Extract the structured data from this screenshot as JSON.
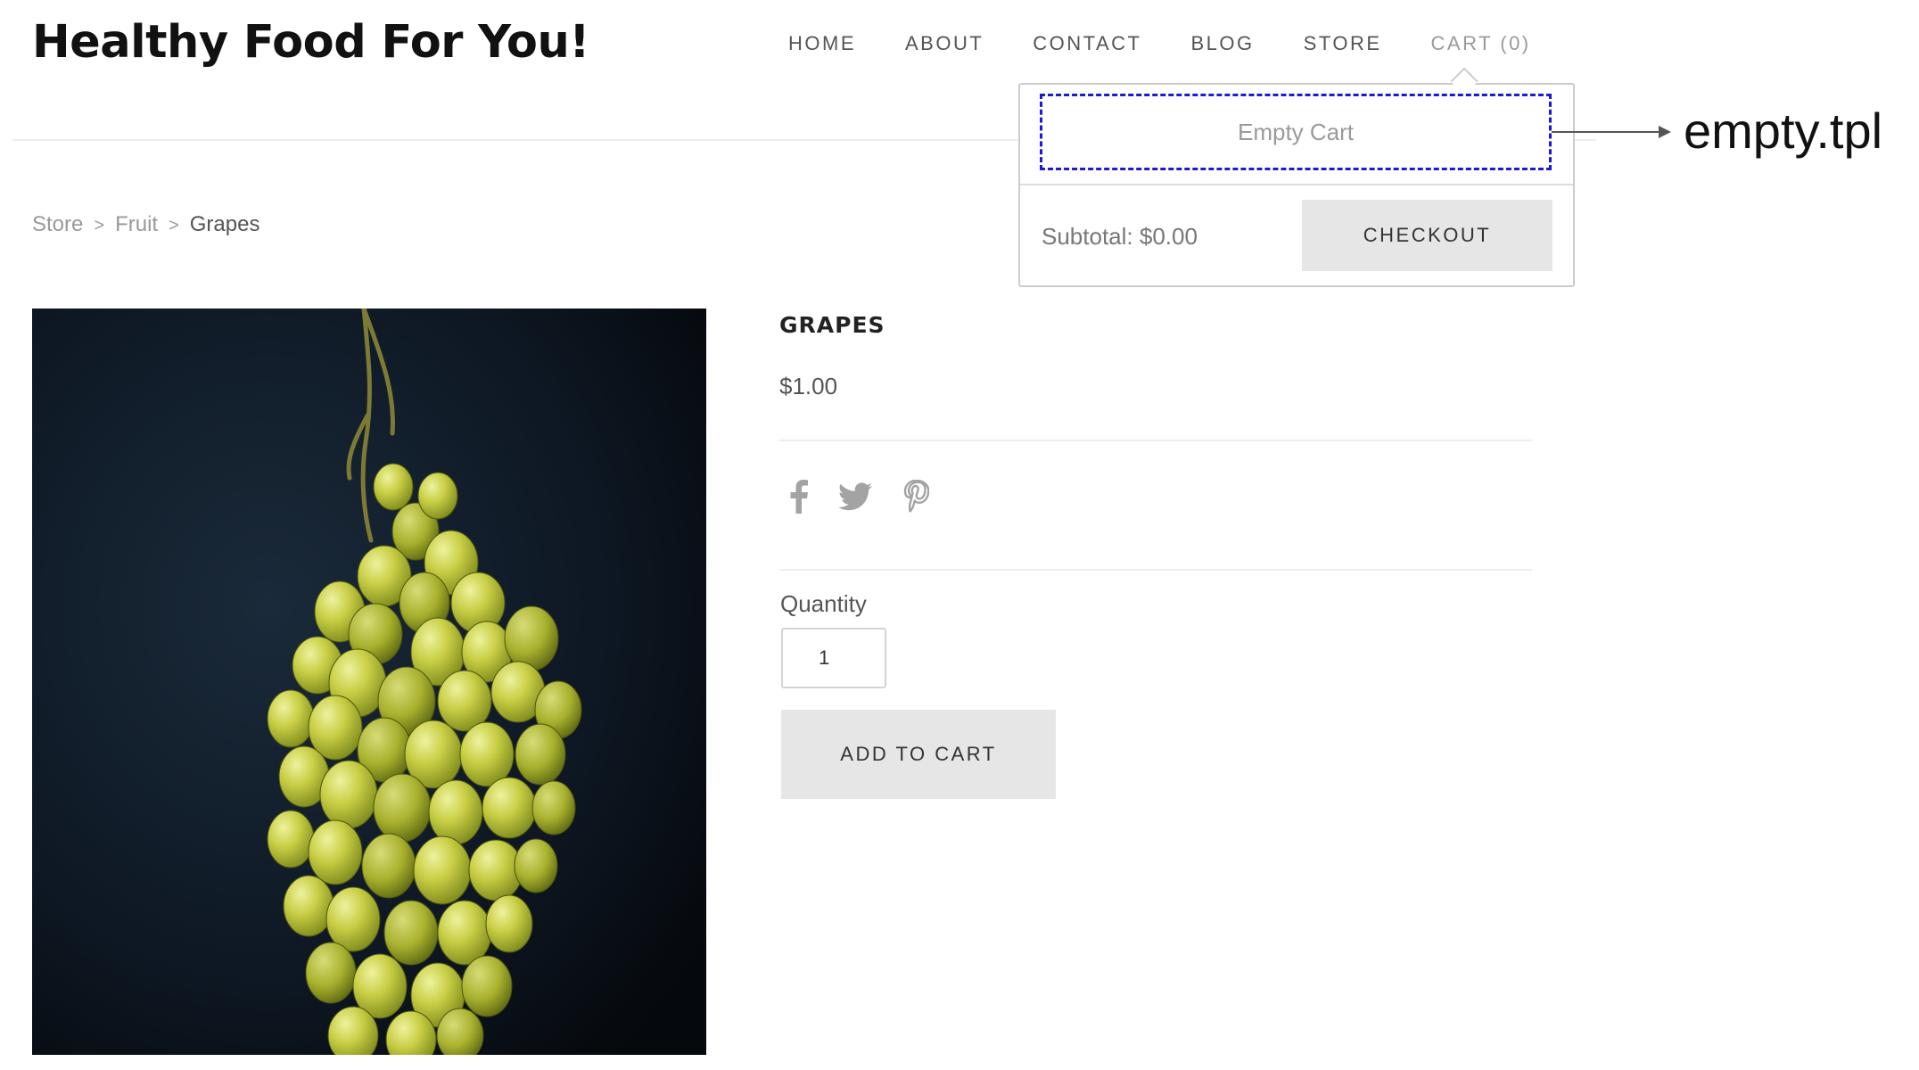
{
  "site": {
    "title": "Healthy Food For You!"
  },
  "nav": {
    "items": [
      "HOME",
      "ABOUT",
      "CONTACT",
      "BLOG",
      "STORE",
      "CART (0)"
    ]
  },
  "breadcrumb": {
    "items": [
      "Store",
      "Fruit",
      "Grapes"
    ],
    "separator": ">"
  },
  "product": {
    "name": "GRAPES",
    "price": "$1.00",
    "image_icon": "grapes-photo",
    "quantity_label": "Quantity",
    "quantity_value": "1",
    "add_to_cart_label": "ADD TO CART",
    "share_icons": [
      "facebook-icon",
      "twitter-icon",
      "pinterest-icon"
    ]
  },
  "cart": {
    "empty_text": "Empty Cart",
    "subtotal": "Subtotal: $0.00",
    "checkout_label": "CHECKOUT"
  },
  "annotation": {
    "label": "empty.tpl",
    "highlight_color": "#1a1ad6"
  },
  "colors": {
    "button_bg": "#e6e6e6",
    "muted_text": "#9a9a9a"
  }
}
